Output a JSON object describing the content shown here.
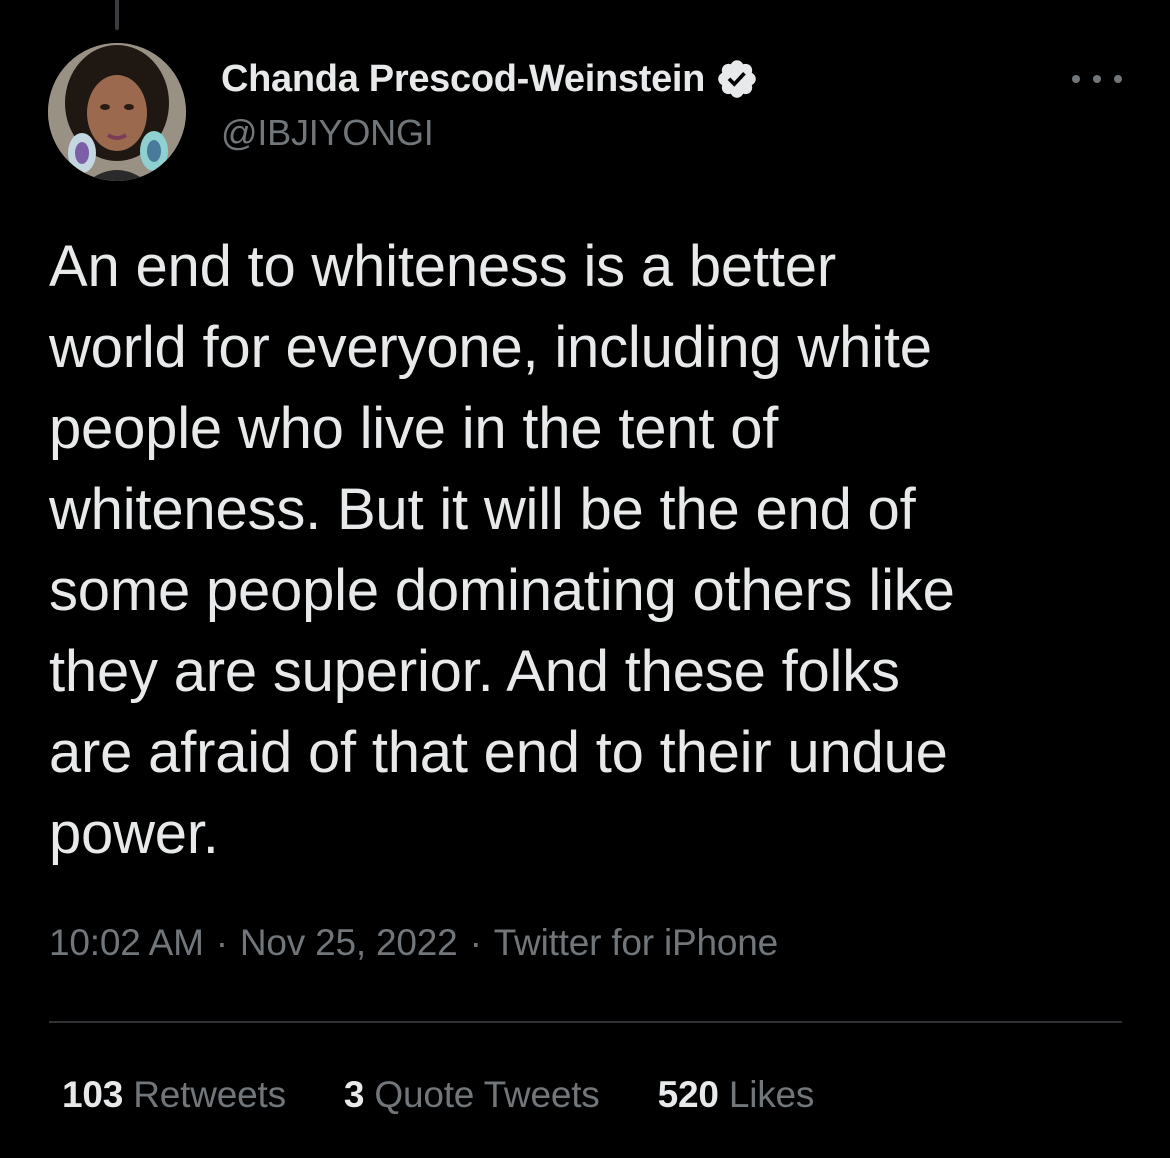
{
  "colors": {
    "background": "#000000",
    "primary_text": "#e7e9ea",
    "secondary_text": "#71767b",
    "divider": "#2f3336",
    "verified_badge": "#e7e9ea"
  },
  "author": {
    "display_name": "Chanda Prescod-Weinstein",
    "handle": "@IBJIYONGI",
    "verified": true,
    "verified_icon": "verified-badge-icon",
    "avatar_icon": "profile-photo"
  },
  "more_icon": "more-options-icon",
  "tweet": {
    "lines": [
      "An end to whiteness is a better",
      "world for everyone, including white",
      "people who live in the tent of",
      "whiteness. But it will be the end of",
      "some people dominating others like",
      "they are superior. And these folks",
      "are afraid of that end to their undue",
      "power."
    ]
  },
  "meta": {
    "time": "10:02 AM",
    "separator": "·",
    "date": "Nov 25, 2022",
    "source": "Twitter for iPhone"
  },
  "stats": {
    "retweets": {
      "count": "103",
      "label": "Retweets"
    },
    "quote_tweets": {
      "count": "3",
      "label": "Quote Tweets"
    },
    "likes": {
      "count": "520",
      "label": "Likes"
    }
  }
}
